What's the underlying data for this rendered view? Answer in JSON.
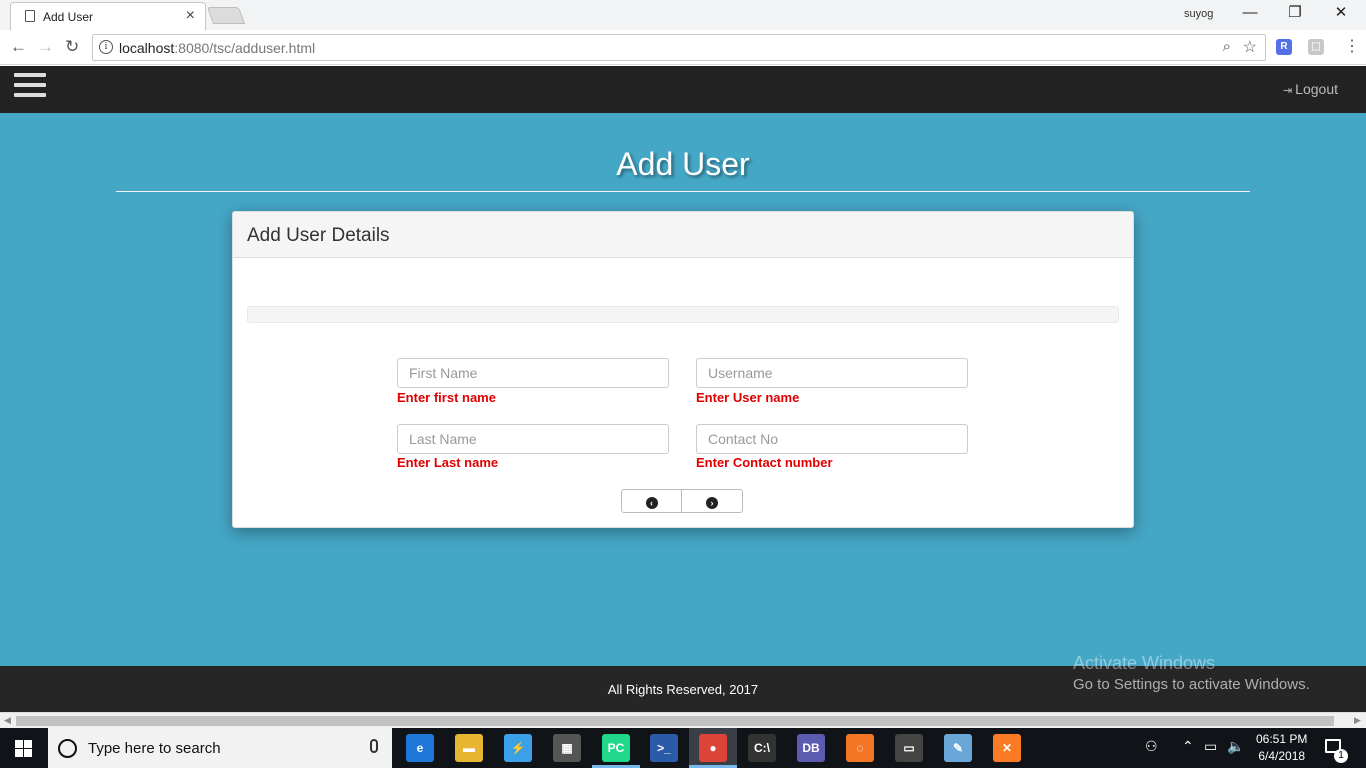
{
  "browser": {
    "tab_title": "Add User",
    "tab_close": "×",
    "user_name": "suyog",
    "window": {
      "minimize": "—",
      "restore": "❐",
      "close": "✕"
    },
    "url_host": "localhost",
    "url_rest": ":8080/tsc/adduser.html",
    "info_icon": "i",
    "extensions": [
      "R",
      "⬚"
    ]
  },
  "navbar": {
    "logout_label": "Logout",
    "logout_icon": "⇥"
  },
  "page": {
    "title": "Add User"
  },
  "panel": {
    "heading": "Add User Details",
    "fields": {
      "first_name": {
        "placeholder": "First Name",
        "value": "",
        "error": "Enter first name"
      },
      "username": {
        "placeholder": "Username",
        "value": "",
        "error": "Enter User name"
      },
      "last_name": {
        "placeholder": "Last Name",
        "value": "",
        "error": "Enter Last name"
      },
      "contact_no": {
        "placeholder": "Contact No",
        "value": "",
        "error": "Enter Contact number"
      }
    },
    "pager": {
      "prev_icon": "‹",
      "next_icon": "›"
    }
  },
  "footer": {
    "text": "All Rights Reserved, 2017"
  },
  "watermark": {
    "line1": "Activate Windows",
    "line2": "Go to Settings to activate Windows."
  },
  "taskbar": {
    "search_placeholder": "Type here to search",
    "apps": [
      {
        "name": "edge-icon",
        "glyph": "e",
        "color": "#1e78d7"
      },
      {
        "name": "file-explorer-icon",
        "glyph": "▬",
        "color": "#e8b530"
      },
      {
        "name": "bolt-app-icon",
        "glyph": "⚡",
        "color": "#3aa0e8"
      },
      {
        "name": "calculator-app-icon",
        "glyph": "▦",
        "color": "#555"
      },
      {
        "name": "pycharm-icon",
        "glyph": "PC",
        "color": "#21d789"
      },
      {
        "name": "powershell-icon",
        "glyph": ">_",
        "color": "#2a5aa8"
      },
      {
        "name": "chrome-icon",
        "glyph": "●",
        "color": "#db4437"
      },
      {
        "name": "cmd-icon",
        "glyph": "C:\\",
        "color": "#333"
      },
      {
        "name": "sqlite-browser-icon",
        "glyph": "DB",
        "color": "#5b5bb0"
      },
      {
        "name": "jupyter-icon",
        "glyph": "◌",
        "color": "#f37626"
      },
      {
        "name": "terminal-icon",
        "glyph": "▭",
        "color": "#444"
      },
      {
        "name": "paint-icon",
        "glyph": "✎",
        "color": "#6aa7d8"
      },
      {
        "name": "xampp-icon",
        "glyph": "✕",
        "color": "#fb7a24"
      }
    ],
    "time": "06:51 PM",
    "date": "6/4/2018",
    "notification_count": "1"
  }
}
